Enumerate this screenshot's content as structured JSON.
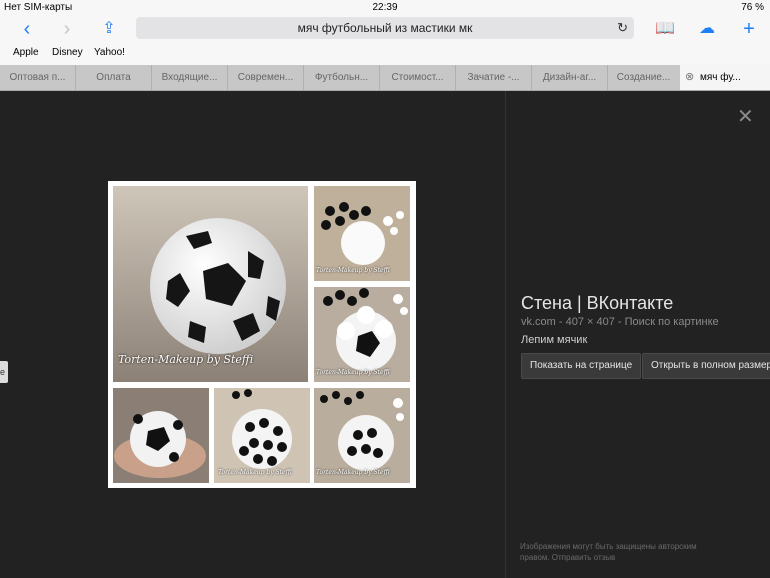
{
  "status_bar": {
    "carrier": "Нет SIM-карты",
    "time": "22:39",
    "battery": "76 %"
  },
  "address_bar": {
    "query": "мяч футбольный из мастики мк"
  },
  "bookmarks": [
    "Apple",
    "Disney",
    "Yahoo!"
  ],
  "tabs": [
    {
      "label": "Оптовая п..."
    },
    {
      "label": "Оплата"
    },
    {
      "label": "Входящие..."
    },
    {
      "label": "Современ..."
    },
    {
      "label": "Футбольн..."
    },
    {
      "label": "Стоимост..."
    },
    {
      "label": "Зачатие -..."
    },
    {
      "label": "Дизайн-аг..."
    },
    {
      "label": "Создание..."
    },
    {
      "label": "мяч фу..."
    }
  ],
  "image_panel": {
    "title": "Стена | ВКонтакте",
    "meta": "vk.com - 407 × 407 - Поиск по картинке",
    "description": "Лепим мячик",
    "btn_page": "Показать на странице",
    "btn_full": "Открыть в полном размере",
    "copyright": "Изображения могут быть защищены авторским правом.",
    "feedback": "Отправить отзыв"
  },
  "watermark": "Torten-Makeup by Steffi"
}
